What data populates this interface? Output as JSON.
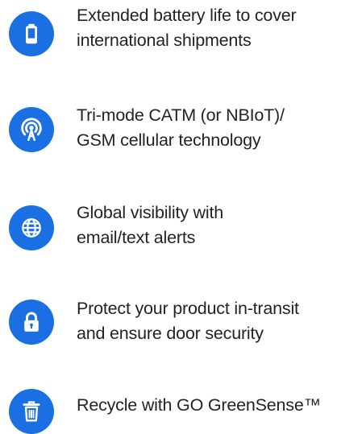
{
  "accent_color": "#1a6fe3",
  "features": [
    {
      "icon": "battery-icon",
      "lines": [
        "Extended battery life to cover",
        "international shipments"
      ]
    },
    {
      "icon": "cellular-antenna-icon",
      "lines": [
        "Tri-mode CATM (or NBIoT)/",
        "GSM cellular technology"
      ]
    },
    {
      "icon": "globe-icon",
      "lines": [
        "Global visibility with",
        "email/text alerts"
      ]
    },
    {
      "icon": "lock-icon",
      "lines": [
        "Protect your product in-transit",
        "and ensure door security"
      ]
    },
    {
      "icon": "trash-can-icon",
      "lines": [
        "Recycle with GO GreenSense™"
      ]
    }
  ]
}
